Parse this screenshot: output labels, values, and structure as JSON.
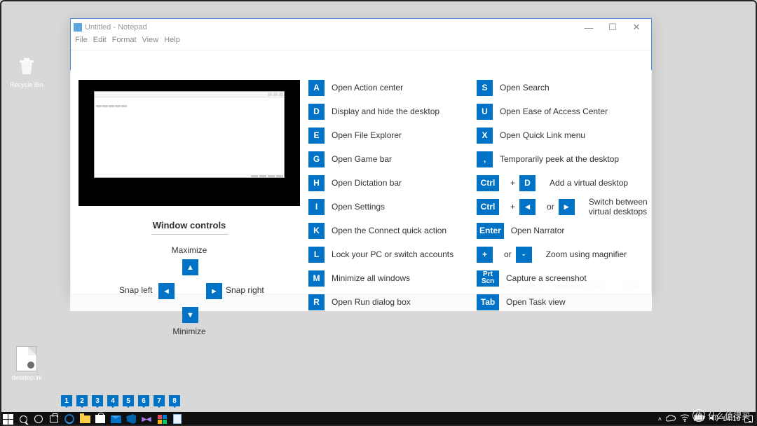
{
  "desktop": {
    "recycle": "Recycle Bin",
    "ini": "desktop.ini"
  },
  "notepad": {
    "title": "Untitled - Notepad",
    "menu": [
      "File",
      "Edit",
      "Format",
      "View",
      "Help"
    ],
    "status": {
      "pos": "Ln 1, Col 1",
      "zoom": "100%",
      "eol": "Windows (CRLF)",
      "enc": "UTF-8"
    }
  },
  "window_controls": {
    "title": "Window controls",
    "maximize": "Maximize",
    "minimize": "Minimize",
    "snap_left": "Snap left",
    "snap_right": "Snap right"
  },
  "shortcuts_left": [
    {
      "key": "A",
      "desc": "Open Action center"
    },
    {
      "key": "D",
      "desc": "Display and hide the desktop"
    },
    {
      "key": "E",
      "desc": "Open File Explorer"
    },
    {
      "key": "G",
      "desc": "Open Game bar"
    },
    {
      "key": "H",
      "desc": "Open Dictation bar"
    },
    {
      "key": "I",
      "desc": "Open Settings"
    },
    {
      "key": "K",
      "desc": "Open the Connect quick action"
    },
    {
      "key": "L",
      "desc": "Lock your PC or switch accounts"
    },
    {
      "key": "M",
      "desc": "Minimize all windows"
    },
    {
      "key": "R",
      "desc": "Open Run dialog box"
    }
  ],
  "shortcuts_right": [
    {
      "type": "single",
      "key": "S",
      "desc": "Open Search"
    },
    {
      "type": "single",
      "key": "U",
      "desc": "Open Ease of Access Center"
    },
    {
      "type": "single",
      "key": "X",
      "desc": "Open Quick Link menu"
    },
    {
      "type": "single",
      "key": ",",
      "desc": "Temporarily peek at the desktop"
    },
    {
      "type": "combo",
      "k1": "Ctrl",
      "plus": "+",
      "k2": "D",
      "desc": "Add a virtual desktop"
    },
    {
      "type": "arrows",
      "k1": "Ctrl",
      "plus": "+",
      "or": "or",
      "desc": "Switch between virtual desktops"
    },
    {
      "type": "single",
      "key": "Enter",
      "wide": true,
      "desc": "Open Narrator"
    },
    {
      "type": "zoom",
      "k1": "+",
      "or": "or",
      "k2": "-",
      "desc": "Zoom using magnifier"
    },
    {
      "type": "single",
      "key": "Prt Scn",
      "wide": true,
      "twoLine": true,
      "desc": "Capture a screenshot"
    },
    {
      "type": "single",
      "key": "Tab",
      "wide": true,
      "desc": "Open Task view"
    }
  ],
  "taskbar_numbers": [
    "1",
    "2",
    "3",
    "4",
    "5",
    "6",
    "7",
    "8"
  ],
  "tray": {
    "time": "14:16"
  },
  "watermark": "什么值得买"
}
